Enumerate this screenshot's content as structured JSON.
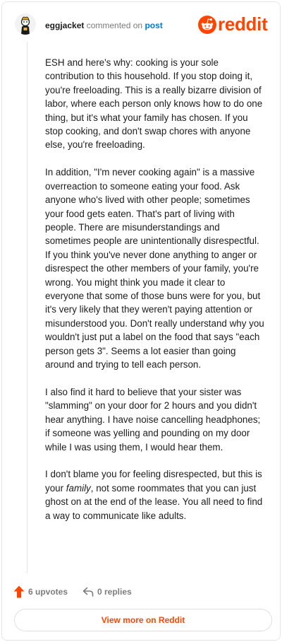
{
  "header": {
    "username": "eggjacket",
    "verb": "commented on",
    "target": "post",
    "logo_word": "reddit"
  },
  "comment": {
    "paragraphs": [
      "ESH and here's why: cooking is your sole contribution to this household. If you stop doing it, you're freeloading. This is a really bizarre division of labor, where each person only knows how to do one thing, but it's what your family has chosen. If you stop cooking, and don't swap chores with anyone else, you're freeloading.",
      "In addition, \"I'm never cooking again\" is a massive overreaction to someone eating your food. Ask anyone who's lived with other people; sometimes your food gets eaten. That's part of living with people. There are misunderstandings and sometimes people are unintentionally disrespectful. If you think you've never done anything to anger or disrespect the other members of your family, you're wrong. You might think you made it clear to everyone that some of those buns were for you, but it's very likely that they weren't paying attention or misunderstood you. Don't really understand why you wouldn't just put a label on the food that says \"each person gets 3\". Seems a lot easier than going around and trying to tell each person.",
      "I also find it hard to believe that your sister was \"slamming\" on your door for 2 hours and you didn't hear anything. I have noise cancelling headphones; if someone was yelling and pounding on my door while I was using them, I would hear them."
    ],
    "p4_before": "I don't blame you for feeling disrespected, but this is your ",
    "p4_em": "family",
    "p4_after": ", not some roommates that you can just ghost on at the end of the lease. You all need to find a way to communicate like adults."
  },
  "footer": {
    "upvotes": "6 upvotes",
    "replies": "0 replies",
    "view_more": "View more on Reddit"
  },
  "colors": {
    "brand": "#ff4500",
    "link": "#0079d3",
    "muted": "#7c7c7c"
  },
  "icons": [
    "avatar",
    "reddit-logo-icon",
    "upvote-arrow-icon",
    "reply-arrow-icon"
  ]
}
